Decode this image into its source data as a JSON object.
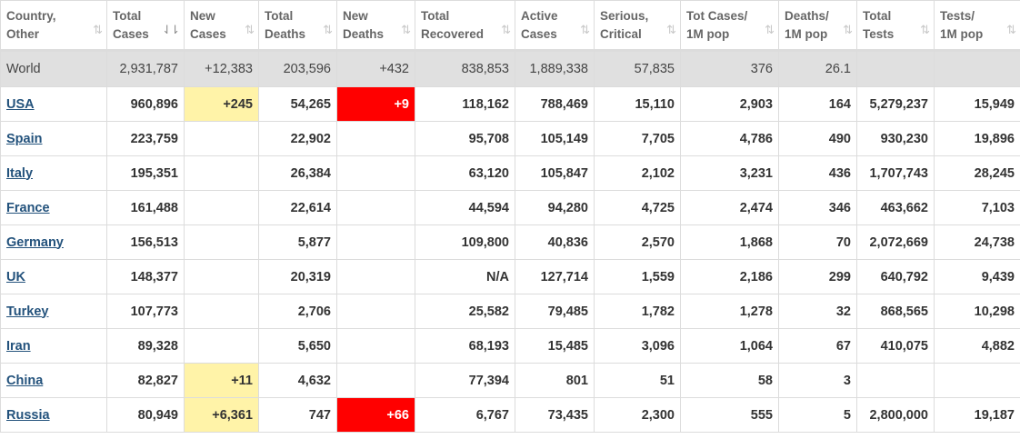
{
  "columns": [
    {
      "l1": "Country,",
      "l2": "Other",
      "sort": "both"
    },
    {
      "l1": "Total",
      "l2": "Cases",
      "sort": "desc"
    },
    {
      "l1": "New",
      "l2": "Cases",
      "sort": "both"
    },
    {
      "l1": "Total",
      "l2": "Deaths",
      "sort": "both"
    },
    {
      "l1": "New",
      "l2": "Deaths",
      "sort": "both"
    },
    {
      "l1": "Total",
      "l2": "Recovered",
      "sort": "both"
    },
    {
      "l1": "Active",
      "l2": "Cases",
      "sort": "both"
    },
    {
      "l1": "Serious,",
      "l2": "Critical",
      "sort": "both"
    },
    {
      "l1": "Tot Cases/",
      "l2": "1M pop",
      "sort": "both"
    },
    {
      "l1": "Deaths/",
      "l2": "1M pop",
      "sort": "both"
    },
    {
      "l1": "Total",
      "l2": "Tests",
      "sort": "both"
    },
    {
      "l1": "Tests/",
      "l2": "1M pop",
      "sort": "both"
    }
  ],
  "sort_icons": {
    "both": "⇅",
    "desc": "⇃⇂"
  },
  "highlight_colors": {
    "new_cases": "#fff3a8",
    "new_deaths": "#ff0000"
  },
  "world": {
    "country": "World",
    "total_cases": "2,931,787",
    "new_cases": "+12,383",
    "total_deaths": "203,596",
    "new_deaths": "+432",
    "total_recovered": "838,853",
    "active_cases": "1,889,338",
    "serious_critical": "57,835",
    "cases_per_1m": "376",
    "deaths_per_1m": "26.1",
    "total_tests": "",
    "tests_per_1m": ""
  },
  "rows": [
    {
      "country": "USA",
      "total_cases": "960,896",
      "new_cases": "+245",
      "total_deaths": "54,265",
      "new_deaths": "+9",
      "total_recovered": "118,162",
      "active_cases": "788,469",
      "serious_critical": "15,110",
      "cases_per_1m": "2,903",
      "deaths_per_1m": "164",
      "total_tests": "5,279,237",
      "tests_per_1m": "15,949"
    },
    {
      "country": "Spain",
      "total_cases": "223,759",
      "new_cases": "",
      "total_deaths": "22,902",
      "new_deaths": "",
      "total_recovered": "95,708",
      "active_cases": "105,149",
      "serious_critical": "7,705",
      "cases_per_1m": "4,786",
      "deaths_per_1m": "490",
      "total_tests": "930,230",
      "tests_per_1m": "19,896"
    },
    {
      "country": "Italy",
      "total_cases": "195,351",
      "new_cases": "",
      "total_deaths": "26,384",
      "new_deaths": "",
      "total_recovered": "63,120",
      "active_cases": "105,847",
      "serious_critical": "2,102",
      "cases_per_1m": "3,231",
      "deaths_per_1m": "436",
      "total_tests": "1,707,743",
      "tests_per_1m": "28,245"
    },
    {
      "country": "France",
      "total_cases": "161,488",
      "new_cases": "",
      "total_deaths": "22,614",
      "new_deaths": "",
      "total_recovered": "44,594",
      "active_cases": "94,280",
      "serious_critical": "4,725",
      "cases_per_1m": "2,474",
      "deaths_per_1m": "346",
      "total_tests": "463,662",
      "tests_per_1m": "7,103"
    },
    {
      "country": "Germany",
      "total_cases": "156,513",
      "new_cases": "",
      "total_deaths": "5,877",
      "new_deaths": "",
      "total_recovered": "109,800",
      "active_cases": "40,836",
      "serious_critical": "2,570",
      "cases_per_1m": "1,868",
      "deaths_per_1m": "70",
      "total_tests": "2,072,669",
      "tests_per_1m": "24,738"
    },
    {
      "country": "UK",
      "total_cases": "148,377",
      "new_cases": "",
      "total_deaths": "20,319",
      "new_deaths": "",
      "total_recovered": "N/A",
      "active_cases": "127,714",
      "serious_critical": "1,559",
      "cases_per_1m": "2,186",
      "deaths_per_1m": "299",
      "total_tests": "640,792",
      "tests_per_1m": "9,439"
    },
    {
      "country": "Turkey",
      "total_cases": "107,773",
      "new_cases": "",
      "total_deaths": "2,706",
      "new_deaths": "",
      "total_recovered": "25,582",
      "active_cases": "79,485",
      "serious_critical": "1,782",
      "cases_per_1m": "1,278",
      "deaths_per_1m": "32",
      "total_tests": "868,565",
      "tests_per_1m": "10,298"
    },
    {
      "country": "Iran",
      "total_cases": "89,328",
      "new_cases": "",
      "total_deaths": "5,650",
      "new_deaths": "",
      "total_recovered": "68,193",
      "active_cases": "15,485",
      "serious_critical": "3,096",
      "cases_per_1m": "1,064",
      "deaths_per_1m": "67",
      "total_tests": "410,075",
      "tests_per_1m": "4,882"
    },
    {
      "country": "China",
      "total_cases": "82,827",
      "new_cases": "+11",
      "total_deaths": "4,632",
      "new_deaths": "",
      "total_recovered": "77,394",
      "active_cases": "801",
      "serious_critical": "51",
      "cases_per_1m": "58",
      "deaths_per_1m": "3",
      "total_tests": "",
      "tests_per_1m": ""
    },
    {
      "country": "Russia",
      "total_cases": "80,949",
      "new_cases": "+6,361",
      "total_deaths": "747",
      "new_deaths": "+66",
      "total_recovered": "6,767",
      "active_cases": "73,435",
      "serious_critical": "2,300",
      "cases_per_1m": "555",
      "deaths_per_1m": "5",
      "total_tests": "2,800,000",
      "tests_per_1m": "19,187"
    }
  ]
}
